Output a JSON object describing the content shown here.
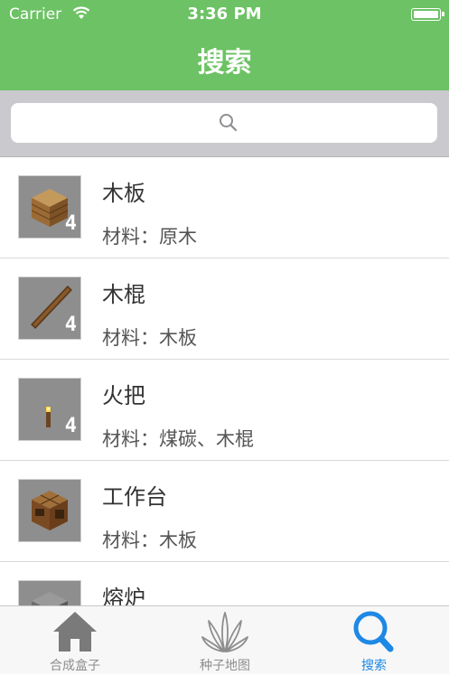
{
  "status_bar": {
    "carrier": "Carrier",
    "time": "3:36 PM"
  },
  "nav": {
    "title": "搜索"
  },
  "search": {
    "placeholder": ""
  },
  "items": [
    {
      "name": "木板",
      "materials": "材料：原木",
      "icon": "wood-planks-icon"
    },
    {
      "name": "木棍",
      "materials": "材料：木板",
      "icon": "stick-icon"
    },
    {
      "name": "火把",
      "materials": "材料：煤碳、木棍",
      "icon": "torch-icon"
    },
    {
      "name": "工作台",
      "materials": "材料：木板",
      "icon": "crafting-table-icon"
    },
    {
      "name": "熔炉",
      "materials": "",
      "icon": "furnace-icon"
    }
  ],
  "item_quantities": [
    "4",
    "4",
    "4"
  ],
  "tabs": [
    {
      "label": "合成盒子",
      "icon": "house-icon",
      "active": false
    },
    {
      "label": "种子地图",
      "icon": "plant-icon",
      "active": false
    },
    {
      "label": "搜索",
      "icon": "search-icon",
      "active": true
    }
  ],
  "colors": {
    "header": "#6cc264",
    "active_tab": "#1e88e5",
    "inactive_tab": "#8e8e8e"
  }
}
